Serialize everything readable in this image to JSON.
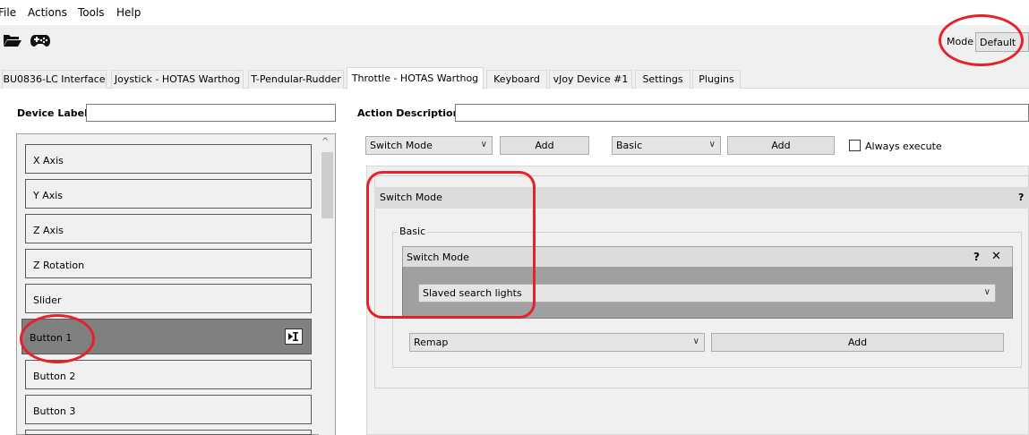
{
  "menu": [
    "File",
    "Actions",
    "Tools",
    "Help"
  ],
  "toolbar": {
    "open_icon": "folder-open-icon",
    "gamepad_icon": "gamepad-icon",
    "mode_label": "Mode",
    "mode_value": "Default"
  },
  "tabs": [
    "BU0836-LC Interface",
    "Joystick - HOTAS Warthog",
    "T-Pendular-Rudder",
    "Throttle - HOTAS Warthog",
    "Keyboard",
    "vJoy Device #1",
    "Settings",
    "Plugins"
  ],
  "active_tab": "Throttle - HOTAS Warthog",
  "device_label": {
    "label": "Device Label",
    "value": ""
  },
  "action_description": {
    "label": "Action Description",
    "value": ""
  },
  "inputs": [
    "X Axis",
    "Y Axis",
    "Z Axis",
    "Z Rotation",
    "Slider",
    "Button 1",
    "Button 2",
    "Button 3"
  ],
  "selected_input": "Button 1",
  "selected_input_icon": "text-cursor-icon",
  "action_toolbar": {
    "action_combo": "Switch Mode",
    "add_action": "Add",
    "container_combo": "Basic",
    "add_container": "Add",
    "always_execute": "Always execute"
  },
  "container": {
    "title": "Switch Mode",
    "help": "?",
    "group_title": "Basic",
    "action": {
      "title": "Switch Mode",
      "help": "?",
      "close": "✕",
      "mode_combo": "Slaved search lights"
    },
    "remap_combo": "Remap",
    "add_button": "Add"
  },
  "annotation_color": "#e8202a"
}
